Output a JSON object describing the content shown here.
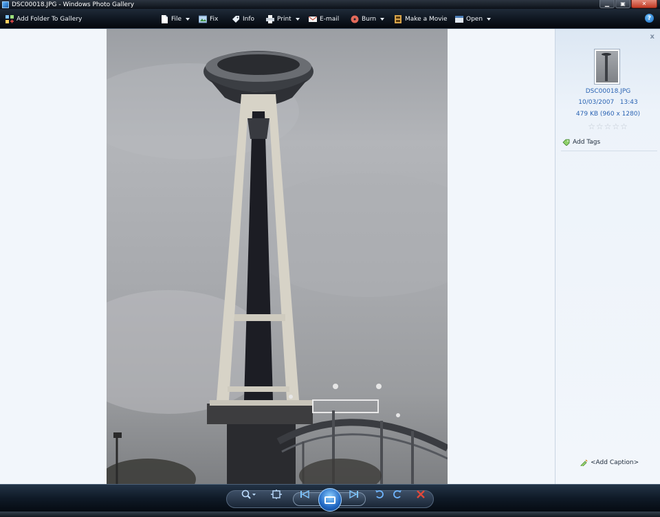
{
  "window": {
    "title": "DSC00018.JPG - Windows Photo Gallery"
  },
  "toolbar": {
    "add_folder": "Add Folder To Gallery",
    "file": "File",
    "fix": "Fix",
    "info": "Info",
    "print": "Print",
    "email": "E-mail",
    "burn": "Burn",
    "make_movie": "Make a Movie",
    "open": "Open"
  },
  "info_pane": {
    "filename": "DSC00018.JPG",
    "date": "10/03/2007",
    "time": "13:43",
    "size": "479 KB (960 x 1280)",
    "rating_stars": "☆☆☆☆☆",
    "add_tags": "Add Tags",
    "add_caption": "<Add Caption>"
  },
  "colors": {
    "accent": "#2a63b3",
    "toolbar_bg": "#0e151f",
    "close_red": "#c23a24"
  }
}
